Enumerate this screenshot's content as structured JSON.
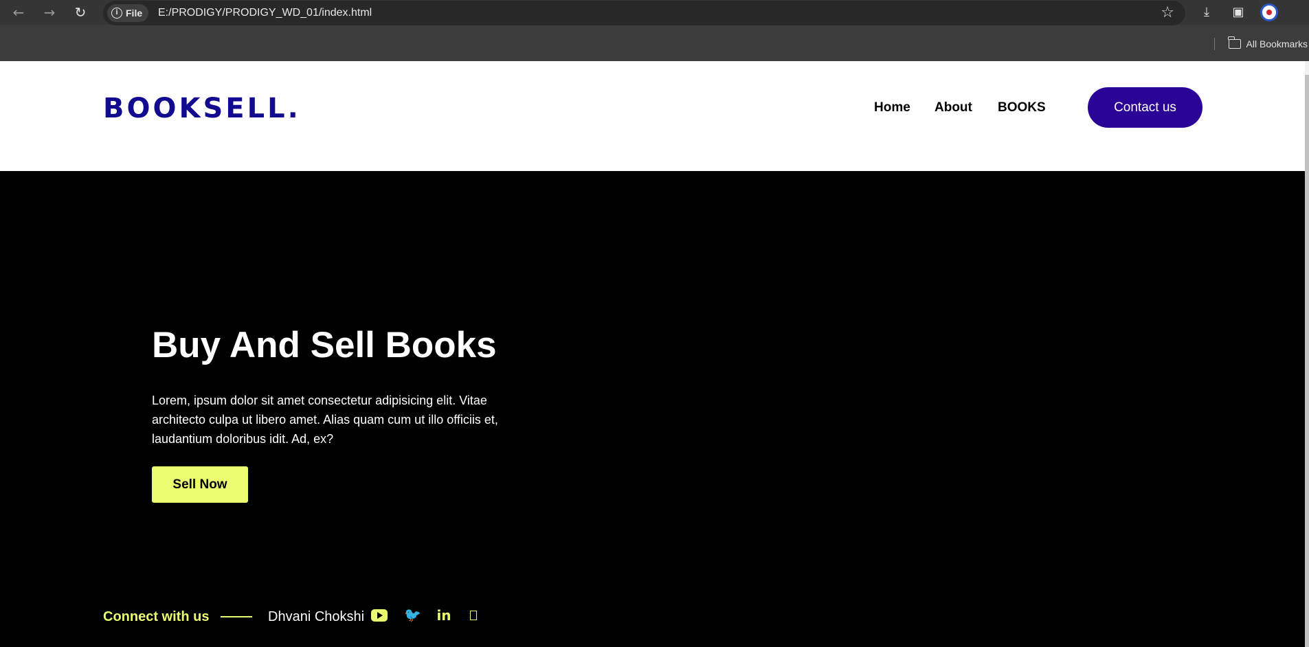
{
  "browser": {
    "back_icon": "←",
    "forward_icon": "→",
    "reload_icon": "↻",
    "file_chip_label": "File",
    "info_icon": "i",
    "url": "E:/PRODIGY/PRODIGY_WD_01/index.html",
    "star_icon": "☆",
    "download_icon": "⤓",
    "sidepanel_icon": "▣",
    "bookmarks_label": "All Bookmarks"
  },
  "header": {
    "logo": "BOOKSELL",
    "logo_dot": ".",
    "nav": {
      "home": "Home",
      "about": "About",
      "books": "BOOKS"
    },
    "contact_label": "Contact us"
  },
  "hero": {
    "title": "Buy And Sell Books",
    "text": "Lorem, ipsum dolor sit amet consectetur adipisicing elit. Vitae architecto culpa ut libero amet. Alias quam cum ut illo officiis et, laudantium doloribus idit. Ad, ex?",
    "button_label": "Sell Now"
  },
  "footer": {
    "connect_label": "Connect with us",
    "name": "Dhvani Chokshi",
    "twitter_glyph": "🐦",
    "linkedin_glyph": "in"
  },
  "colors": {
    "brand_blue": "#120a8f",
    "contact_button": "#2a0497",
    "accent_yellow": "#ebfc71",
    "hero_background": "#000000"
  }
}
